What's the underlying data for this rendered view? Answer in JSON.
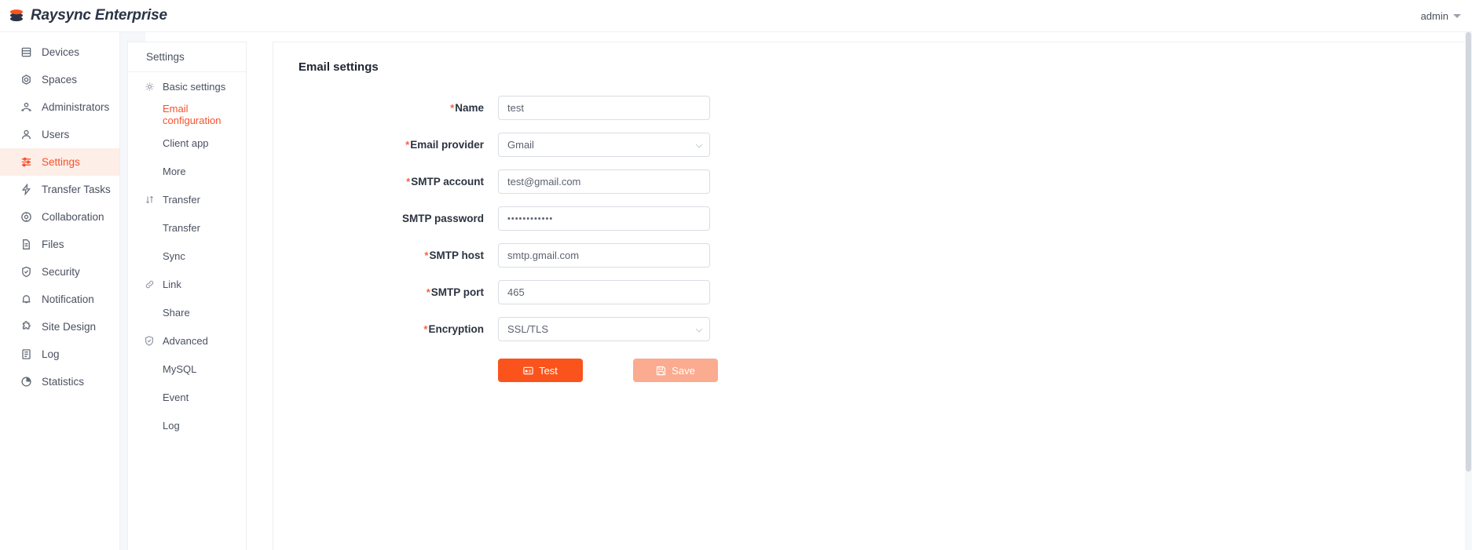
{
  "app": {
    "brand_name": "Raysync Enterprise",
    "logo_icon": "raysync-logo-icon",
    "accent_color": "#fa541c",
    "active_bg_color": "#fdeee8",
    "required_color": "#f5604a"
  },
  "topbar": {
    "user_label": "admin",
    "caret_icon": "caret-down-icon"
  },
  "sidebar": {
    "items": [
      {
        "label": "Devices",
        "icon": "server-icon",
        "active": false
      },
      {
        "label": "Spaces",
        "icon": "hexagon-icon",
        "active": false
      },
      {
        "label": "Administrators",
        "icon": "users-icon",
        "active": false
      },
      {
        "label": "Users",
        "icon": "user-icon",
        "active": false
      },
      {
        "label": "Settings",
        "icon": "sliders-icon",
        "active": true
      },
      {
        "label": "Transfer Tasks",
        "icon": "transfer-icon",
        "active": false
      },
      {
        "label": "Collaboration",
        "icon": "collaboration-icon",
        "active": false
      },
      {
        "label": "Files",
        "icon": "file-icon",
        "active": false
      },
      {
        "label": "Security",
        "icon": "shield-check-icon",
        "active": false
      },
      {
        "label": "Notification",
        "icon": "bell-icon",
        "active": false
      },
      {
        "label": "Site Design",
        "icon": "puzzle-icon",
        "active": false
      },
      {
        "label": "Log",
        "icon": "log-icon",
        "active": false
      },
      {
        "label": "Statistics",
        "icon": "pie-chart-icon",
        "active": false
      }
    ]
  },
  "subpanel": {
    "title": "Settings",
    "groups": [
      {
        "label": "Basic settings",
        "icon": "gear-icon",
        "children": [
          {
            "label": "Email configuration",
            "active": true
          },
          {
            "label": "Client app",
            "active": false
          },
          {
            "label": "More",
            "active": false
          }
        ]
      },
      {
        "label": "Transfer",
        "icon": "transfer-arrows-icon",
        "children": [
          {
            "label": "Transfer",
            "active": false
          },
          {
            "label": "Sync",
            "active": false
          }
        ]
      },
      {
        "label": "Link",
        "icon": "link-icon",
        "children": [
          {
            "label": "Share",
            "active": false
          }
        ]
      },
      {
        "label": "Advanced",
        "icon": "shield-check-icon",
        "children": [
          {
            "label": "MySQL",
            "active": false
          },
          {
            "label": "Event",
            "active": false
          },
          {
            "label": "Log",
            "active": false
          }
        ]
      }
    ]
  },
  "main": {
    "page_title": "Email settings",
    "fields": [
      {
        "label": "Name",
        "required": true,
        "value": "test",
        "type": "text"
      },
      {
        "label": "Email provider",
        "required": true,
        "value": "Gmail",
        "type": "select"
      },
      {
        "label": "SMTP account",
        "required": true,
        "value": "test@gmail.com",
        "type": "text"
      },
      {
        "label": "SMTP password",
        "required": false,
        "value": "••••••••••••",
        "type": "password"
      },
      {
        "label": "SMTP host",
        "required": true,
        "value": "smtp.gmail.com",
        "type": "text"
      },
      {
        "label": "SMTP port",
        "required": true,
        "value": "465",
        "type": "text"
      },
      {
        "label": "Encryption",
        "required": true,
        "value": "SSL/TLS",
        "type": "select"
      }
    ],
    "buttons": {
      "test_label": "Test",
      "test_icon": "mail-test-icon",
      "save_label": "Save",
      "save_icon": "save-disk-icon",
      "save_disabled": true
    }
  }
}
